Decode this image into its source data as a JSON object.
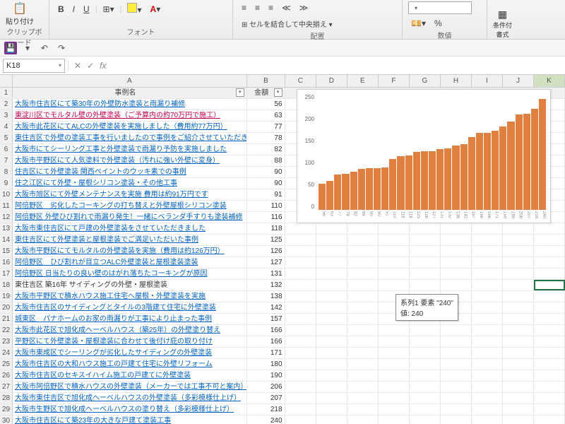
{
  "ribbon": {
    "groups": {
      "clipboard": {
        "label": "クリップボード",
        "paste": "貼り付け"
      },
      "font": {
        "label": "フォント",
        "bold": "B",
        "italic": "I",
        "underline": "U"
      },
      "alignment": {
        "label": "配置",
        "merge": "セルを結合して中央揃え"
      },
      "number": {
        "label": "数値"
      },
      "styles": {
        "cond": "条件付\n書式"
      }
    }
  },
  "qat": {
    "undo": "↶",
    "redo": "↷"
  },
  "namebox": {
    "ref": "K18",
    "fx": "fx"
  },
  "columns": [
    "",
    "A",
    "B",
    "C",
    "D",
    "E",
    "F",
    "G",
    "H",
    "I",
    "J",
    "K"
  ],
  "headers": {
    "name": "事例名",
    "amount": "金額"
  },
  "rows": [
    {
      "n": 1,
      "name": "",
      "amt": "",
      "hdr": true
    },
    {
      "n": 2,
      "name": "大阪市住吉区にて築30年の外壁防水塗装と雨漏り補修",
      "amt": 56
    },
    {
      "n": 3,
      "name": "東淀川区でモルタル壁の外壁塗装（ご予算内の約70万円で施工）",
      "amt": 63,
      "red": true
    },
    {
      "n": 4,
      "name": "大阪市此花区にてALCの外壁塗装を実施しました（費用約77万円）",
      "amt": 77
    },
    {
      "n": 5,
      "name": "東住吉区で外壁の塗装工事を行いましたので事例をご紹介させていただきます。",
      "amt": 78
    },
    {
      "n": 6,
      "name": "大阪市にてシーリング工事と外壁塗装で雨漏り予防を実施しました",
      "amt": 82
    },
    {
      "n": 7,
      "name": "大阪市平野区にて人気塗料で外壁塗装（汚れに強い外壁に変身）",
      "amt": 88
    },
    {
      "n": 8,
      "name": "住吉区にて外壁塗装 関西ペイントのウッキ素での事例",
      "amt": 90
    },
    {
      "n": 9,
      "name": "住之江区にて外壁・屋根シリコン塗装・その他工事",
      "amt": 90
    },
    {
      "n": 10,
      "name": "大阪市旭区にて外壁メンテナンスを実施 費用は約91万円です",
      "amt": 91
    },
    {
      "n": 11,
      "name": "阿倍野区　劣化したコーキングの打ち替えと外壁屋根シリコン塗装",
      "amt": 110
    },
    {
      "n": 12,
      "name": "阿倍野区 外壁ひび割れで雨漏り発生！一緒にベランダ手すりも塗装補修",
      "amt": 116
    },
    {
      "n": 13,
      "name": "大阪市東住吉区にて戸建の外壁塗装をさせていただきました",
      "amt": 118
    },
    {
      "n": 14,
      "name": "東住吉区にて外壁塗装と屋根塗装でご満足いただいた事例",
      "amt": 125
    },
    {
      "n": 15,
      "name": "大阪市平野区にてモルタルの外壁塗装を実施（費用は約126万円）",
      "amt": 126
    },
    {
      "n": 16,
      "name": "阿倍野区　ひび割れが目立つALC外壁塗装と屋根塗装塗装",
      "amt": 127
    },
    {
      "n": 17,
      "name": "阿倍野区 日当たりの良い壁のはがれ落ちたコーキングが原因",
      "amt": 131
    },
    {
      "n": 18,
      "name": "東住吉区 築16年 サイディングの外壁・屋根塗装",
      "amt": 132,
      "nolink": true
    },
    {
      "n": 19,
      "name": "大阪市平野区で積水ハウス施工住宅へ屋根・外壁塗装を実施",
      "amt": 138
    },
    {
      "n": 20,
      "name": "大阪市住吉区のサイディングとタイルの3階建て住宅に外壁塗装",
      "amt": 142
    },
    {
      "n": 21,
      "name": "城東区　パナホームのお家の雨漏りが工事により止まった事例",
      "amt": 157
    },
    {
      "n": 22,
      "name": "大阪市此花区で旭化成ヘーベルハウス（築25年）の外壁塗り替え",
      "amt": 166
    },
    {
      "n": 23,
      "name": "平野区にて外壁塗装・屋根塗装に合わせて後付け庇の取り付け",
      "amt": 166
    },
    {
      "n": 24,
      "name": "大阪市東成区でシーリングが劣化したサイディングの外壁塗装",
      "amt": 171
    },
    {
      "n": 25,
      "name": "大阪市住吉区の大和ハウス施工の戸建て住宅に外壁リフォーム",
      "amt": 180
    },
    {
      "n": 26,
      "name": "大阪市住吉区のセキスイハイム施工の戸建てに外壁塗装",
      "amt": 190
    },
    {
      "n": 27,
      "name": "大阪市阿倍野区で積水ハウスの外壁塗装（メーカーでは工事不可と案内）",
      "amt": 206
    },
    {
      "n": 28,
      "name": "大阪市東住吉区で旭化成ヘーベルハウスの外壁塗装（多彩模様仕上げ）",
      "amt": 207
    },
    {
      "n": 29,
      "name": "大阪市生野区で旭化成ヘーベルハウスの塗り替え（多彩模様仕上げ）",
      "amt": 218
    },
    {
      "n": 30,
      "name": "大阪市住吉区にて築23年の大きな戸建て塗装工事",
      "amt": 240
    }
  ],
  "chart_data": {
    "type": "bar",
    "title": "",
    "ylabel": "",
    "xlabel": "",
    "ylim": [
      0,
      250
    ],
    "yticks": [
      0,
      50,
      100,
      150,
      200,
      250
    ],
    "categories": [
      56,
      63,
      77,
      78,
      82,
      88,
      90,
      90,
      91,
      110,
      116,
      118,
      125,
      126,
      127,
      131,
      132,
      138,
      142,
      157,
      166,
      166,
      171,
      180,
      190,
      206,
      207,
      218,
      240
    ],
    "values": [
      56,
      63,
      77,
      78,
      82,
      88,
      90,
      90,
      91,
      110,
      116,
      118,
      125,
      126,
      127,
      131,
      132,
      138,
      142,
      157,
      166,
      166,
      171,
      180,
      190,
      206,
      207,
      218,
      240
    ],
    "series_name": "系列1"
  },
  "tooltip": {
    "line1": "系列1 要素 \"240\"",
    "line2": "値: 240"
  },
  "selected_cell": "K18"
}
